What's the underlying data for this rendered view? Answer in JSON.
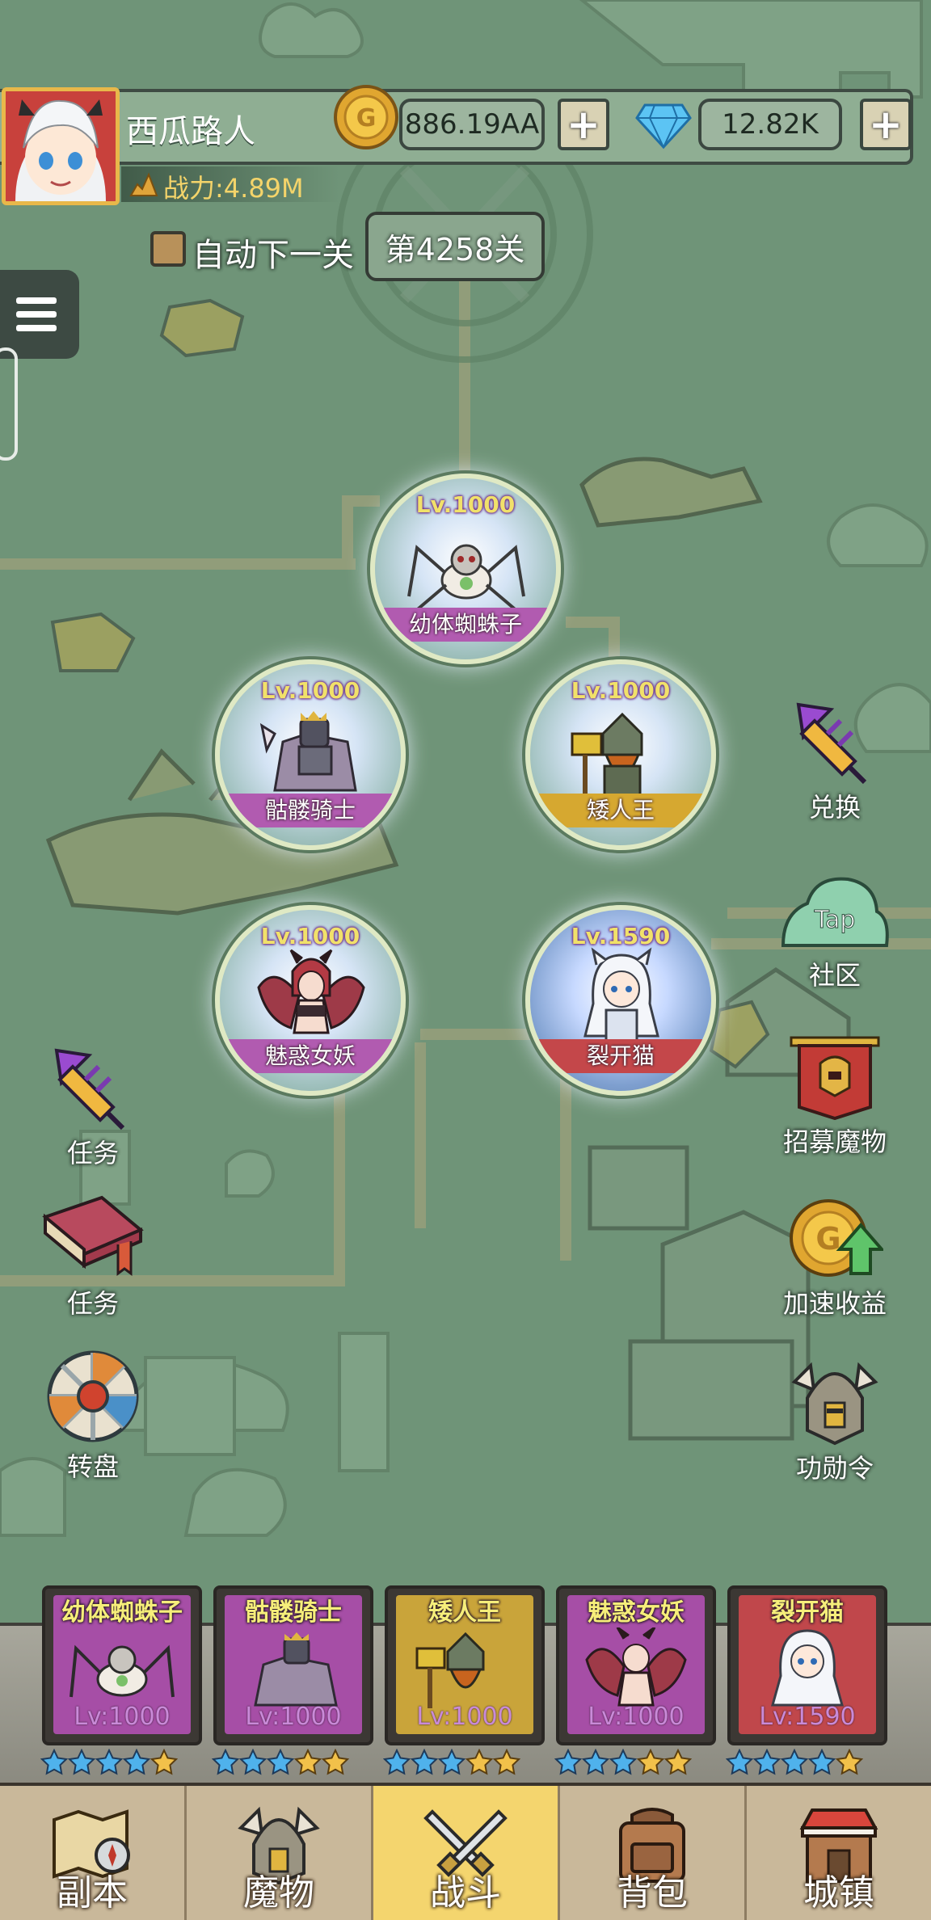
{
  "player": {
    "name": "西瓜路人",
    "power": "战力:4.89M"
  },
  "resources": {
    "gold": "886.19AA",
    "gems": "12.82K"
  },
  "stage": {
    "auto_next_label": "自动下一关",
    "current": "第4258关"
  },
  "monsters": [
    {
      "level": "Lv.1000",
      "name": "幼体蜘蛛子",
      "band": "#b15bb0"
    },
    {
      "level": "Lv.1000",
      "name": "骷髅骑士",
      "band": "#b15bb0"
    },
    {
      "level": "Lv.1000",
      "name": "矮人王",
      "band": "#d6a830"
    },
    {
      "level": "Lv.1000",
      "name": "魅惑女妖",
      "band": "#b15bb0"
    },
    {
      "level": "Lv.1590",
      "name": "裂开猫",
      "band": "#c4474a"
    }
  ],
  "side_actions": {
    "left": [
      "任务",
      "任务",
      "转盘"
    ],
    "right": [
      "兑换",
      "社区",
      "招募魔物",
      "加速收益",
      "功勋令"
    ]
  },
  "team": [
    {
      "name": "幼体蜘蛛子",
      "level": "Lv:1000",
      "color": "#a64ea6"
    },
    {
      "name": "骷髅骑士",
      "level": "Lv:1000",
      "color": "#a64ea6"
    },
    {
      "name": "矮人王",
      "level": "Lv:1000",
      "color": "#c9a43a"
    },
    {
      "name": "魅惑女妖",
      "level": "Lv:1000",
      "color": "#a64ea6"
    },
    {
      "name": "裂开猫",
      "level": "Lv:1590",
      "color": "#c0474b"
    }
  ],
  "nav": {
    "items": [
      "副本",
      "魔物",
      "战斗",
      "背包",
      "城镇"
    ],
    "active": "战斗"
  },
  "icons": {
    "firework": "firework-rocket-icon",
    "tap": "taptap-cloud-icon",
    "recruit": "recruit-banner-icon",
    "speed": "gold-coin-arrow-icon",
    "medal": "helmet-medal-icon",
    "book": "quest-book-icon",
    "wheel": "spin-wheel-icon"
  }
}
